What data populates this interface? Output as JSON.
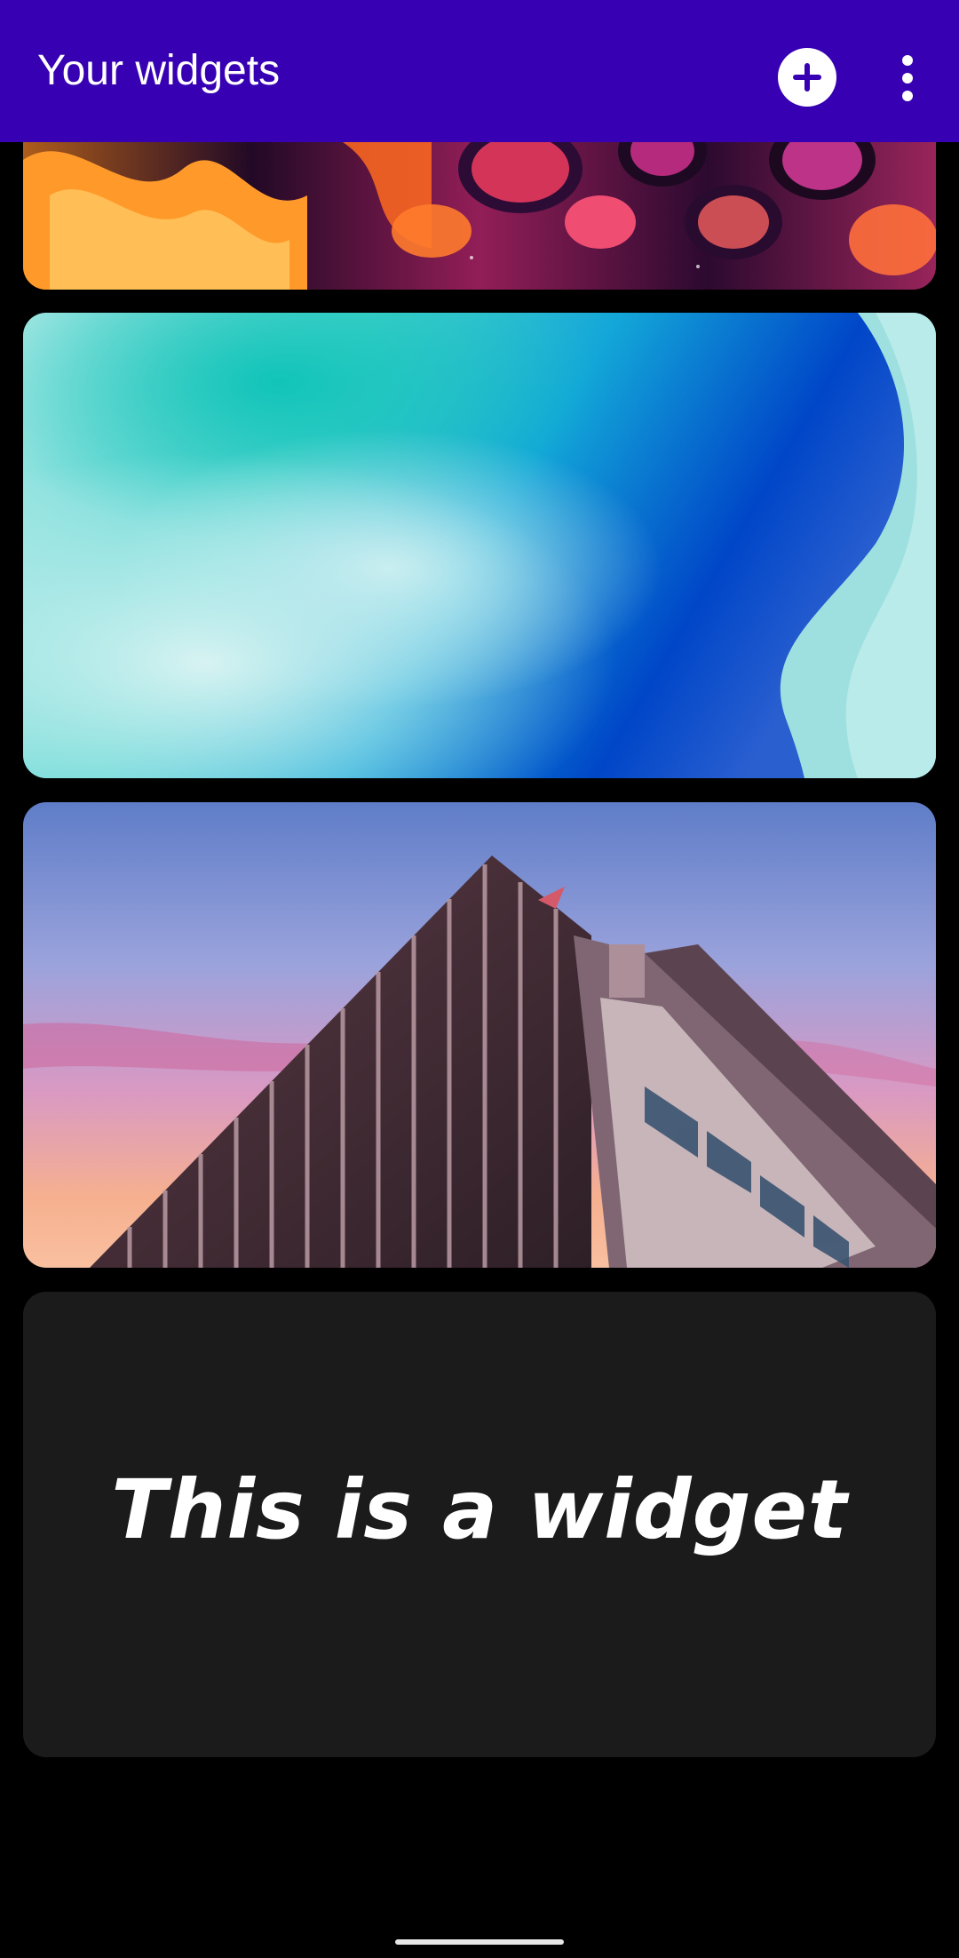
{
  "app_bar": {
    "title": "Your widgets",
    "background_color": "#3700b3",
    "add_icon": "plus-circle-icon",
    "more_icon": "more-vert-icon"
  },
  "widgets": [
    {
      "kind": "image",
      "description": "abstract orange pink fluid art"
    },
    {
      "kind": "image",
      "description": "teal blue gradient wave"
    },
    {
      "kind": "image",
      "description": "building against purple pink sunset sky"
    },
    {
      "kind": "text",
      "text": "This is a widget",
      "background_color": "#1b1b1b"
    }
  ]
}
